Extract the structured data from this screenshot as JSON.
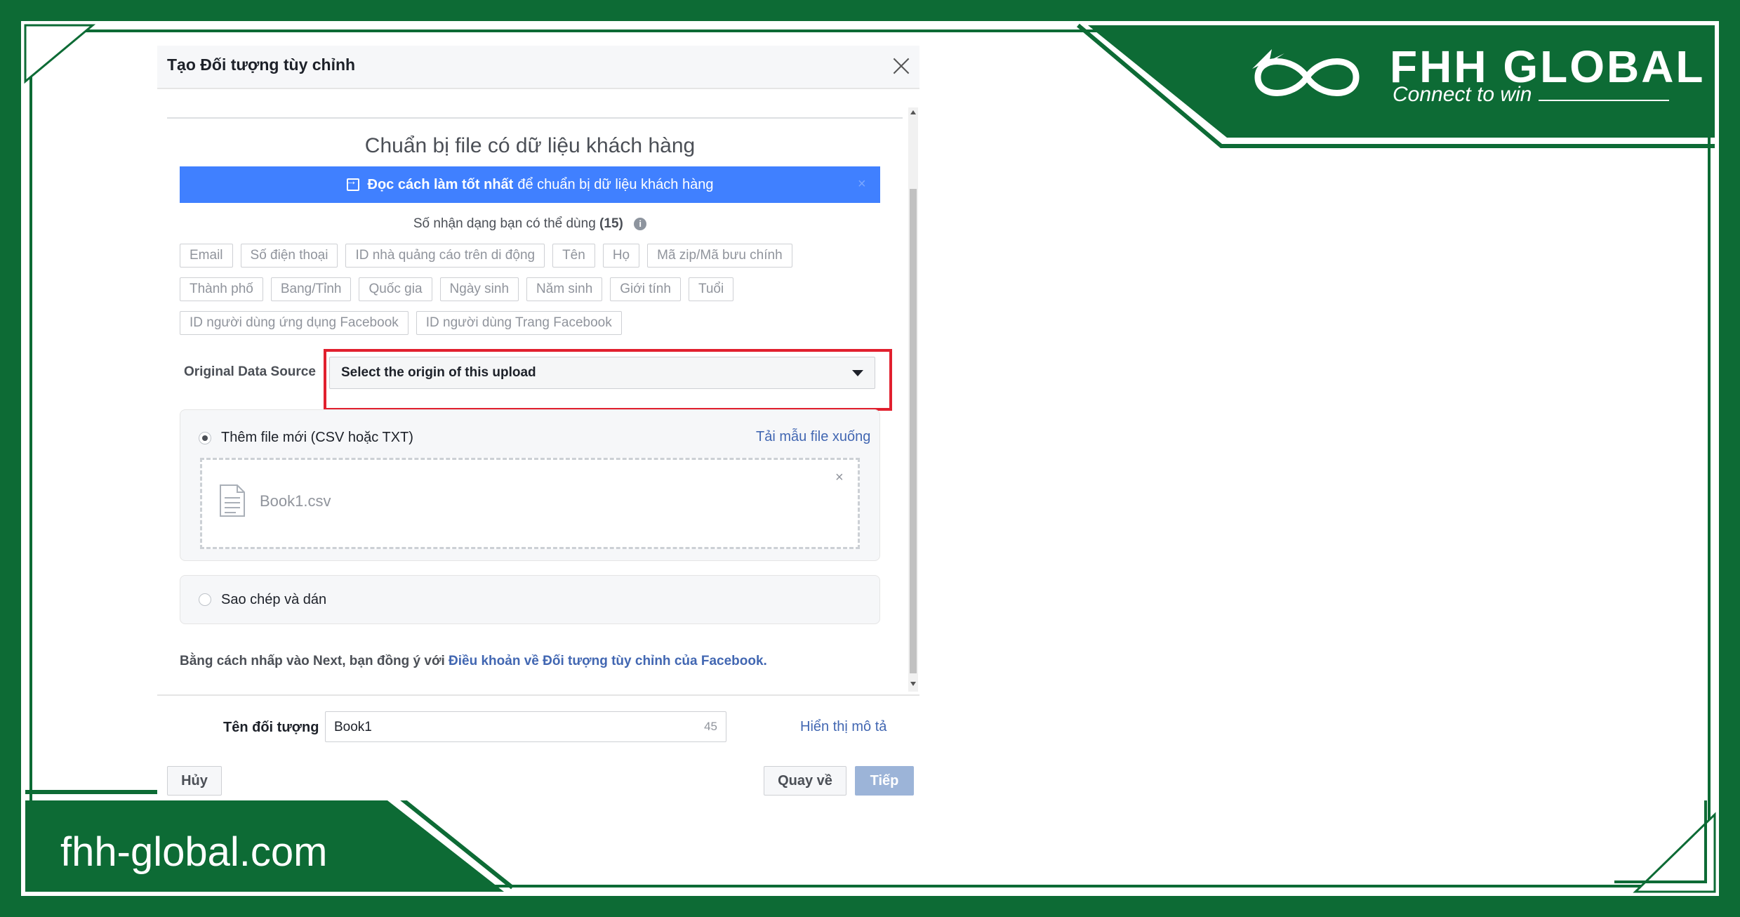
{
  "dialog": {
    "title": "Tạo Đối tượng tùy chỉnh",
    "section_heading": "Chuẩn bị file có dữ liệu khách hàng",
    "banner": {
      "bold": "Đọc cách làm tốt nhất",
      "rest": "để chuẩn bị dữ liệu khách hàng",
      "close": "×"
    },
    "id_types": {
      "title": "Số nhận dạng bạn có thể dùng",
      "count": "(15)",
      "info": "i",
      "row1": [
        "Email",
        "Số điện thoại",
        "ID nhà quảng cáo trên di động",
        "Tên",
        "Họ",
        "Mã zip/Mã bưu chính"
      ],
      "row2": [
        "Thành phố",
        "Bang/Tỉnh",
        "Quốc gia",
        "Ngày sinh",
        "Năm sinh",
        "Giới tính",
        "Tuổi"
      ],
      "row3": [
        "ID người dùng ứng dụng Facebook",
        "ID người dùng Trang Facebook"
      ]
    },
    "original_data_source": {
      "label": "Original Data Source",
      "placeholder": "Select the origin of this upload"
    },
    "upload": {
      "option_label": "Thêm file mới (CSV hoặc TXT)",
      "download_link": "Tải mẫu file xuống",
      "file_name": "Book1.csv",
      "remove": "×"
    },
    "paste": {
      "option_label": "Sao chép và dán"
    },
    "terms": {
      "prefix": "Bằng cách nhấp vào Next, bạn đồng ý với",
      "link": "Điều khoản về Đối tượng tùy chỉnh của Facebook."
    },
    "audience_name": {
      "label": "Tên đối tượng",
      "value": "Book1",
      "counter": "45"
    },
    "show_description": "Hiển thị mô tả",
    "buttons": {
      "cancel": "Hủy",
      "back": "Quay về",
      "next": "Tiếp"
    }
  },
  "branding": {
    "name": "FHH GLOBAL",
    "tagline": "Connect to win",
    "website": "fhh-global.com",
    "colors": {
      "green": "#0d6b35",
      "accent_red": "#e1202e",
      "link_blue": "#4267b2",
      "banner_blue": "#4080ff"
    }
  }
}
